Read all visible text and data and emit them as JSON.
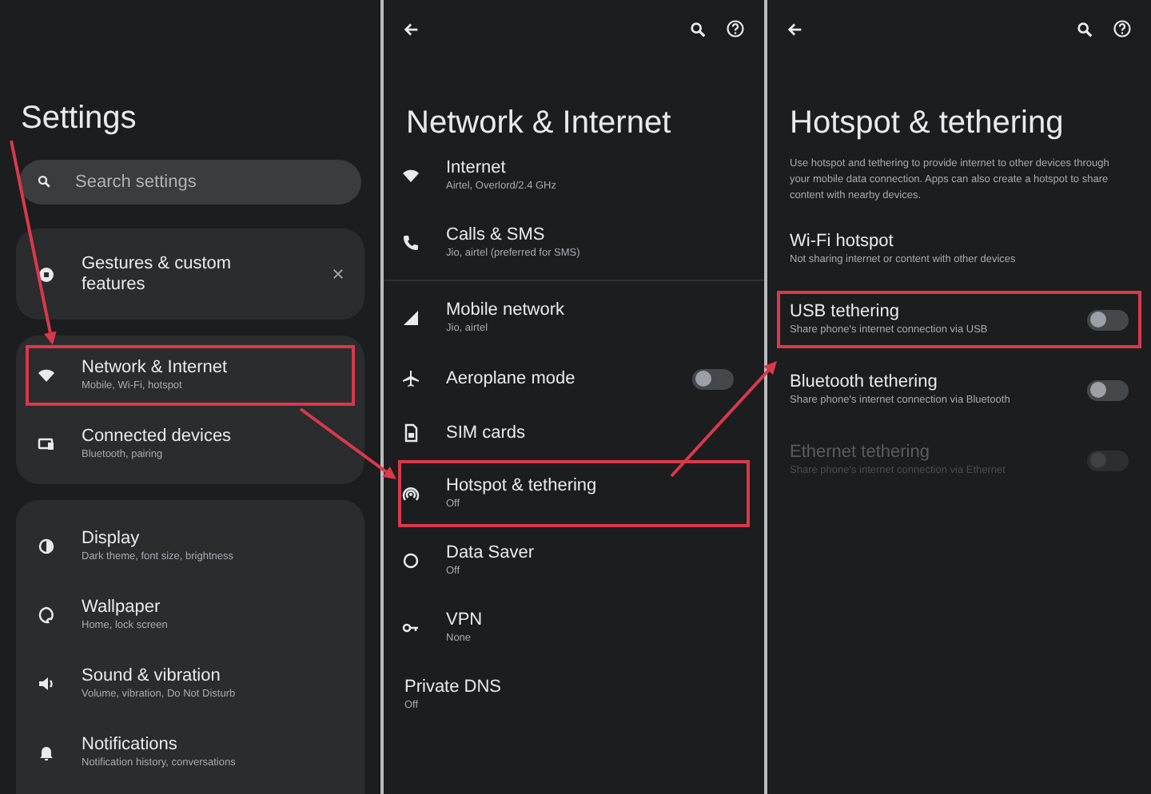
{
  "screens": [
    {
      "kind": "home",
      "title": "Settings",
      "search": {
        "placeholder": "Search settings"
      },
      "cards": [
        {
          "dismissible": true,
          "items": [
            {
              "title": "Gestures & custom features",
              "highlighted": false
            }
          ]
        },
        {
          "items": [
            {
              "title": "Network & Internet",
              "subtitle": "Mobile, Wi-Fi, hotspot",
              "highlighted": true
            },
            {
              "title": "Connected devices",
              "subtitle": "Bluetooth, pairing",
              "highlighted": false
            }
          ]
        },
        {
          "items": [
            {
              "title": "Display",
              "subtitle": "Dark theme, font size, brightness",
              "highlighted": false
            },
            {
              "title": "Wallpaper",
              "subtitle": "Home, lock screen",
              "highlighted": false
            },
            {
              "title": "Sound & vibration",
              "subtitle": "Volume, vibration, Do Not Disturb",
              "highlighted": false
            },
            {
              "title": "Notifications",
              "subtitle": "Notification history, conversations",
              "highlighted": false
            }
          ]
        }
      ]
    },
    {
      "kind": "subpage",
      "title": "Network & Internet",
      "items": [
        {
          "title": "Internet",
          "subtitle": "Airtel, Overlord/2.4 GHz",
          "highlighted": false
        },
        {
          "title": "Calls & SMS",
          "subtitle": "Jio, airtel (preferred for SMS)",
          "highlighted": false
        },
        {
          "title": "Mobile network",
          "subtitle": "Jio, airtel",
          "highlighted": false,
          "divider_before": true
        },
        {
          "title": "Aeroplane mode",
          "highlighted": false,
          "switch": {
            "on": false,
            "disabled": false
          }
        },
        {
          "title": "SIM cards",
          "highlighted": false
        },
        {
          "title": "Hotspot & tethering",
          "subtitle": "Off",
          "highlighted": true
        },
        {
          "title": "Data Saver",
          "subtitle": "Off",
          "highlighted": false
        },
        {
          "title": "VPN",
          "subtitle": "None",
          "highlighted": false
        },
        {
          "title": "Private DNS",
          "subtitle": "Off",
          "highlighted": false
        }
      ]
    },
    {
      "kind": "subpage",
      "title": "Hotspot & tethering",
      "description": "Use hotspot and tethering to provide internet to other devices through your mobile data connection. Apps can also create a hotspot to share content with nearby devices.",
      "items": [
        {
          "title": "Wi-Fi hotspot",
          "subtitle": "Not sharing internet or content with other devices",
          "highlighted": false
        },
        {
          "title": "USB tethering",
          "subtitle": "Share phone's internet connection via USB",
          "highlighted": true,
          "switch": {
            "on": false,
            "disabled": false
          }
        },
        {
          "title": "Bluetooth tethering",
          "subtitle": "Share phone's internet connection via Bluetooth",
          "highlighted": false,
          "switch": {
            "on": false,
            "disabled": false
          }
        },
        {
          "title": "Ethernet tethering",
          "subtitle": "Share phone's internet connection via Ethernet",
          "highlighted": false,
          "switch": {
            "on": false,
            "disabled": true
          }
        }
      ]
    }
  ]
}
